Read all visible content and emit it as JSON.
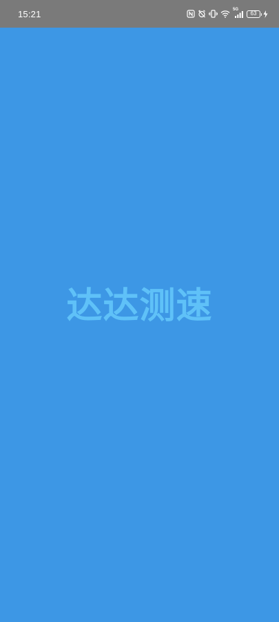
{
  "status_bar": {
    "time": "15:21",
    "network_type": "5G",
    "battery_level": "63",
    "icons": [
      "nfc-icon",
      "alarm-off-icon",
      "vibrate-icon",
      "wifi-icon",
      "cellular-signal-icon",
      "battery-icon",
      "charging-icon"
    ],
    "background_color": "#7a7a7a"
  },
  "splash": {
    "app_name": "达达测速",
    "background_color": "#3d97e5",
    "title_color": "#5fc1f8"
  }
}
